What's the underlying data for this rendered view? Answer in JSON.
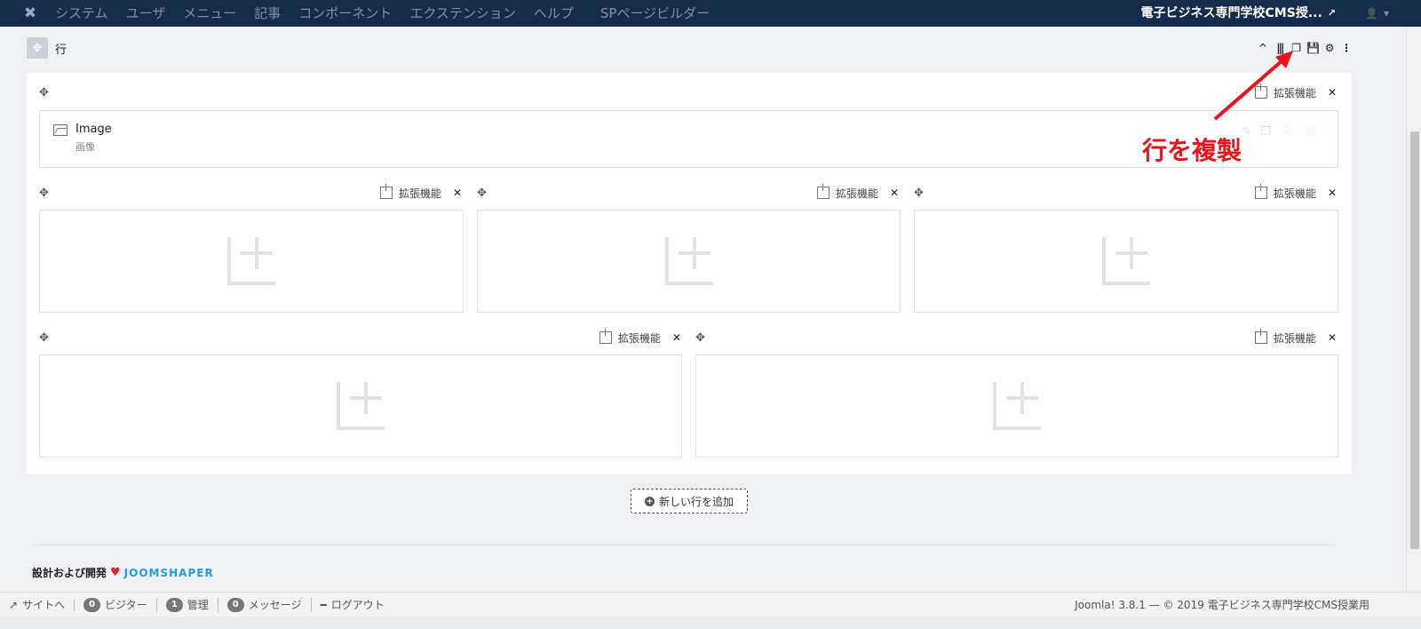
{
  "navbar": {
    "logo_icon": "joomla-icon",
    "items": [
      "システム",
      "ユーザ",
      "メニュー",
      "記事",
      "コンポーネント",
      "エクステンション",
      "ヘルプ",
      "SPページビルダー"
    ],
    "site_title": "電子ビジネス専門学校CMS授...",
    "external_icon": "↗",
    "user_icon": "👤",
    "user_caret": "▾"
  },
  "row": {
    "drag_icon": "✥",
    "title": "行",
    "tools": [
      "^",
      "|||",
      "❐",
      "💾",
      "⚙",
      "⋮"
    ]
  },
  "labels": {
    "add_addon": "拡張機能",
    "move_icon": "✥",
    "wrench_icon": "✕"
  },
  "addon": {
    "name": "Image",
    "subtitle": "画像",
    "tools": [
      "✎",
      "❐",
      "👁",
      "🗑"
    ]
  },
  "add_row_button": {
    "label": "新しい行を追加",
    "icon": "+"
  },
  "credit": {
    "text": "設計および開発",
    "heart": "♥",
    "brand": "JOOMSHAPER"
  },
  "annotation": {
    "text": "行を複製",
    "color": "#e8161c"
  },
  "statusbar": {
    "site_link": "サイトへ",
    "visitors_count": "0",
    "visitors_label": "ビジター",
    "admins_count": "1",
    "admins_label": "管理",
    "messages_count": "0",
    "messages_label": "メッセージ",
    "logout_label": "ログアウト",
    "footer": "Joomla! 3.8.1  —  © 2019 電子ビジネス専門学校CMS授業用"
  }
}
